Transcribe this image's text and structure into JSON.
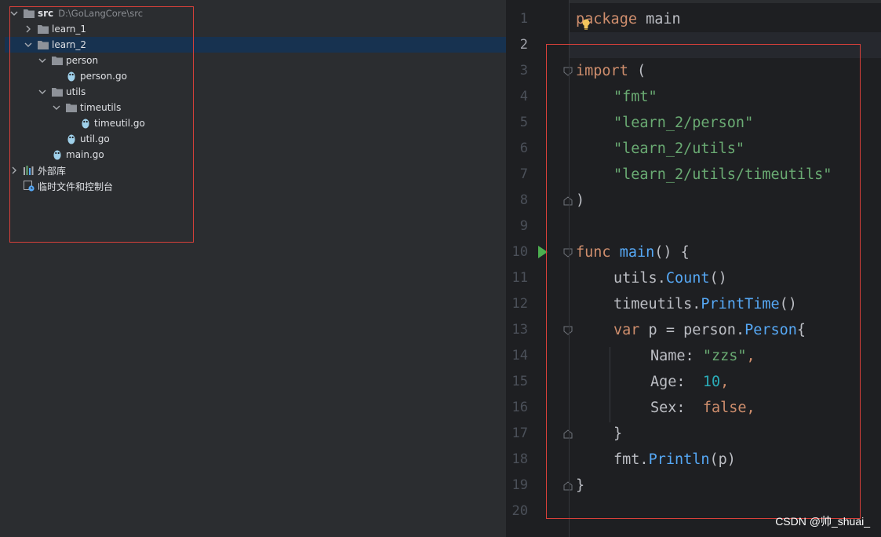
{
  "project_tree": {
    "root": {
      "label": "src",
      "path": "D:\\GoLangCore\\src"
    },
    "items": [
      {
        "label": "learn_1"
      },
      {
        "label": "learn_2"
      },
      {
        "label": "person"
      },
      {
        "label": "person.go"
      },
      {
        "label": "utils"
      },
      {
        "label": "timeutils"
      },
      {
        "label": "timeutil.go"
      },
      {
        "label": "util.go"
      },
      {
        "label": "main.go"
      },
      {
        "label": "外部库"
      },
      {
        "label": "临时文件和控制台"
      }
    ]
  },
  "editor": {
    "current_line": "2",
    "line_numbers": [
      "1",
      "2",
      "3",
      "4",
      "5",
      "6",
      "7",
      "8",
      "9",
      "10",
      "11",
      "12",
      "13",
      "14",
      "15",
      "16",
      "17",
      "18",
      "19",
      "20"
    ],
    "code": {
      "l1": {
        "kw": "package",
        "rest": " main"
      },
      "l3": {
        "kw": "import",
        "rest": " ("
      },
      "l4": "\"fmt\"",
      "l5": "\"learn_2/person\"",
      "l6": "\"learn_2/utils\"",
      "l7": "\"learn_2/utils/timeutils\"",
      "l8": ")",
      "l10": {
        "kw": "func",
        "name": "main",
        "rest": "() {"
      },
      "l11": {
        "pkg": "utils",
        "dot": ".",
        "call": "Count",
        "rest": "()"
      },
      "l12": {
        "pkg": "timeutils",
        "dot": ".",
        "call": "PrintTime",
        "rest": "()"
      },
      "l13": {
        "kw": "var",
        "mid": " p = person.",
        "type": "Person",
        "rest": "{"
      },
      "l14": {
        "field": "Name:",
        "val": "\"zzs\"",
        "comma": ","
      },
      "l15": {
        "field": "Age:",
        "val": "10",
        "comma": ","
      },
      "l16": {
        "field": "Sex:",
        "val": "false",
        "comma": ","
      },
      "l17": "}",
      "l18": {
        "pkg": "fmt",
        "dot": ".",
        "call": "Println",
        "rest": "(p)"
      },
      "l19": "}"
    }
  },
  "watermark": "CSDN @帅_shuai_",
  "colors": {
    "keyword": "#cf8e6d",
    "string": "#6aab73",
    "number": "#2aacb8",
    "function": "#56a8f5",
    "highlight_box": "#d9403a",
    "selection": "#173250"
  },
  "icons": {
    "folder": "folder-icon",
    "go_file": "go-file-icon",
    "libraries": "external-libraries-icon",
    "scratches": "scratches-icon",
    "run": "run-gutter-icon",
    "intention": "lightbulb-icon"
  }
}
